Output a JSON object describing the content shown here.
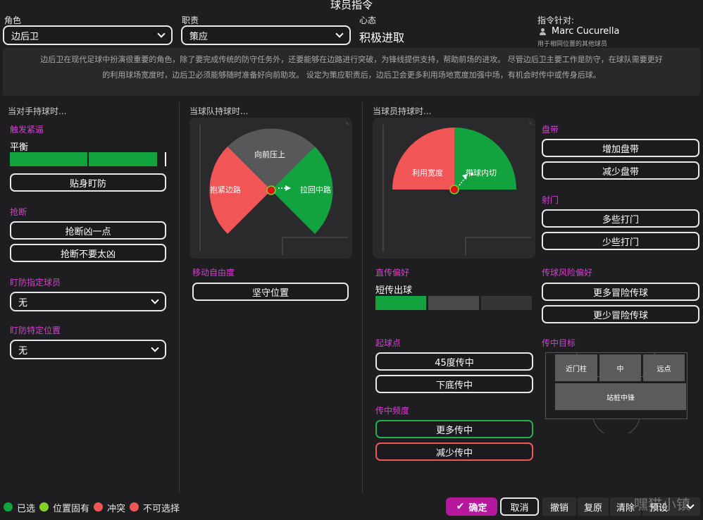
{
  "header": {
    "title": "球员指令"
  },
  "role": {
    "label": "角色",
    "value": "边后卫"
  },
  "duty": {
    "label": "职责",
    "value": "策应"
  },
  "mentality": {
    "label": "心态",
    "value": "积极进取"
  },
  "target": {
    "label": "指令针对:",
    "player": "Marc Cucurella",
    "note": "用于相同位置的其他球员"
  },
  "description": {
    "line1": "边后卫在现代足球中扮演很重要的角色，除了要完成传统的防守任务外，还要能够在边路进行突破，为锋线提供支持，帮助前场的进攻。 尽管边后卫主要工作是防守，在球队需要更好",
    "line2": "的利用球场宽度时，边后卫必须能够随时准备好向前助攻。 设定为策应职责后，边后卫会更多利用场地宽度加强中场，有机会时传中或传身后球。"
  },
  "col1": {
    "head": "当对手持球时...",
    "press": {
      "title": "触发紧逼",
      "level_label": "平衡",
      "button": "贴身盯防"
    },
    "tackle": {
      "title": "抢断",
      "btn1": "抢断凶一点",
      "btn2": "抢断不要太凶"
    },
    "mark_player": {
      "title": "盯防指定球员",
      "value": "无"
    },
    "mark_position": {
      "title": "盯防特定位置",
      "value": "无"
    }
  },
  "col2": {
    "head": "当球队持球时...",
    "wheel": {
      "top": "向前压上",
      "left": "抱紧边路",
      "right": "拉回中路"
    },
    "freedom": {
      "title": "移动自由度",
      "button": "坚守位置"
    }
  },
  "col3": {
    "head": "当球员持球时...",
    "wheel": {
      "left": "利用宽度",
      "right": "带球内切"
    },
    "pass": {
      "title": "直传偏好",
      "level_label": "短传出球"
    },
    "cross_from": {
      "title": "起球点",
      "btn1": "45度传中",
      "btn2": "下底传中"
    },
    "cross_freq": {
      "title": "传中频度",
      "btn1": "更多传中",
      "btn2": "减少传中"
    }
  },
  "col4": {
    "dribble": {
      "title": "盘带",
      "btn1": "增加盘带",
      "btn2": "减少盘带"
    },
    "shoot": {
      "title": "射门",
      "btn1": "多些打门",
      "btn2": "少些打门"
    },
    "risk": {
      "title": "传球风险偏好",
      "btn1": "更多冒险传球",
      "btn2": "更少冒险传球"
    },
    "cross_target": {
      "title": "传中目标",
      "near": "近门柱",
      "center": "中",
      "far": "远点",
      "target_man": "站桩中锋"
    }
  },
  "legend": {
    "selected": "已选",
    "fixed": "位置固有",
    "conflict": "冲突",
    "unavailable": "不可选择"
  },
  "footer": {
    "confirm": "确定",
    "cancel": "取消",
    "undo": "撤销",
    "reset": "复原",
    "clear": "清除",
    "preset": "预设"
  },
  "watermark": "嘿猫小镇",
  "colors": {
    "green": "#12a33f",
    "red": "#f15555",
    "magenta": "#b5179e",
    "accent_label": "#d63fd0"
  },
  "levels": {
    "press": 0.94,
    "pass": 0.33
  }
}
